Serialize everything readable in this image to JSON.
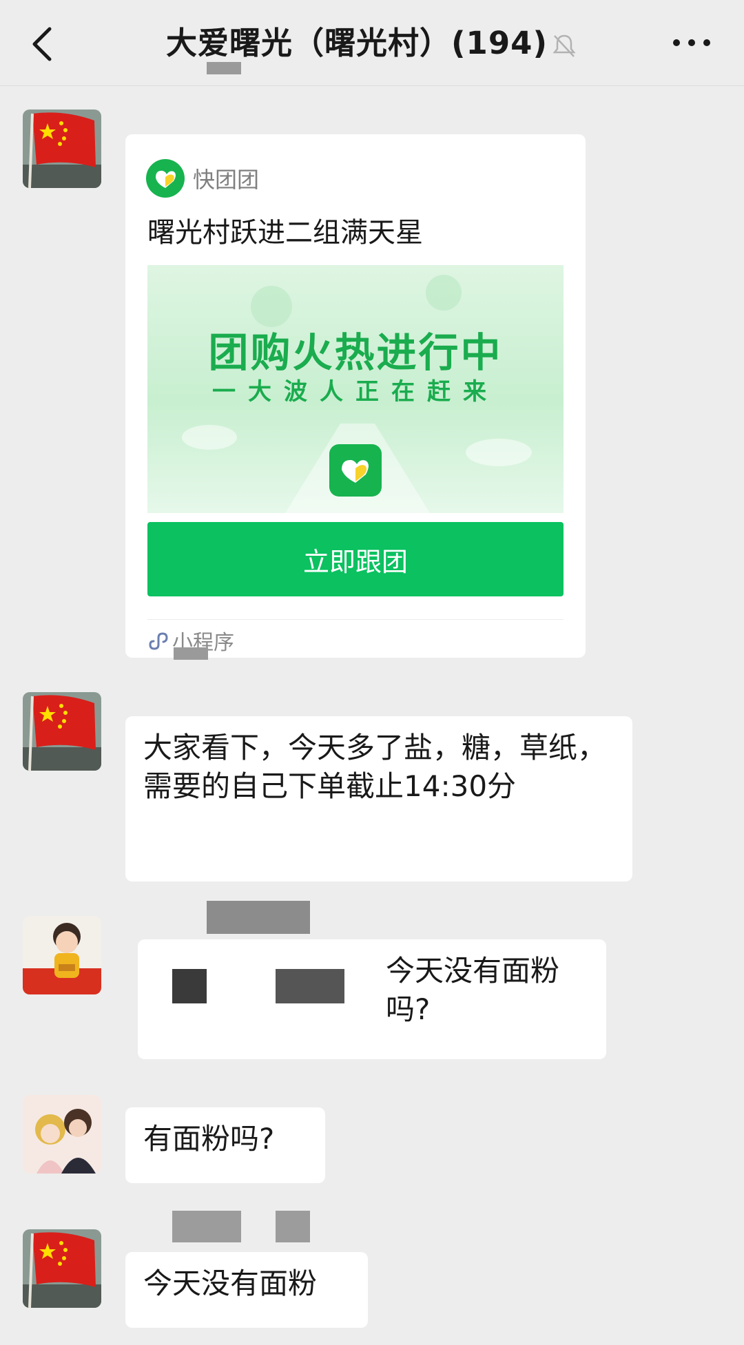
{
  "header": {
    "title": "大爱曙光（曙光村）(194)",
    "icons": {
      "back": "chevron-left-icon",
      "mute": "bell-slash-icon",
      "more": "more-dots-icon"
    }
  },
  "messages": [
    {
      "type": "mini_program_card",
      "avatar": "china-flag-avatar",
      "app_name": "快团团",
      "card_title": "曙光村跃进二组满天星",
      "banner_title": "团购火热进行中",
      "banner_subtitle": "一大波人正在赶来",
      "button_label": "立即跟团",
      "footer_label": "小程序"
    },
    {
      "type": "text",
      "avatar": "china-flag-avatar",
      "text": "大家看下，今天多了盐，糖，草纸，需要的自己下单截止14:30分"
    },
    {
      "type": "text",
      "avatar": "baby-photo-avatar",
      "text": "今天没有面粉吗?"
    },
    {
      "type": "text",
      "avatar": "couple-illustration-avatar",
      "text": "有面粉吗?"
    },
    {
      "type": "text",
      "avatar": "china-flag-avatar",
      "text": "今天没有面粉"
    }
  ],
  "colors": {
    "background": "#ededed",
    "accent_green": "#0bc160",
    "bubble": "#ffffff"
  }
}
